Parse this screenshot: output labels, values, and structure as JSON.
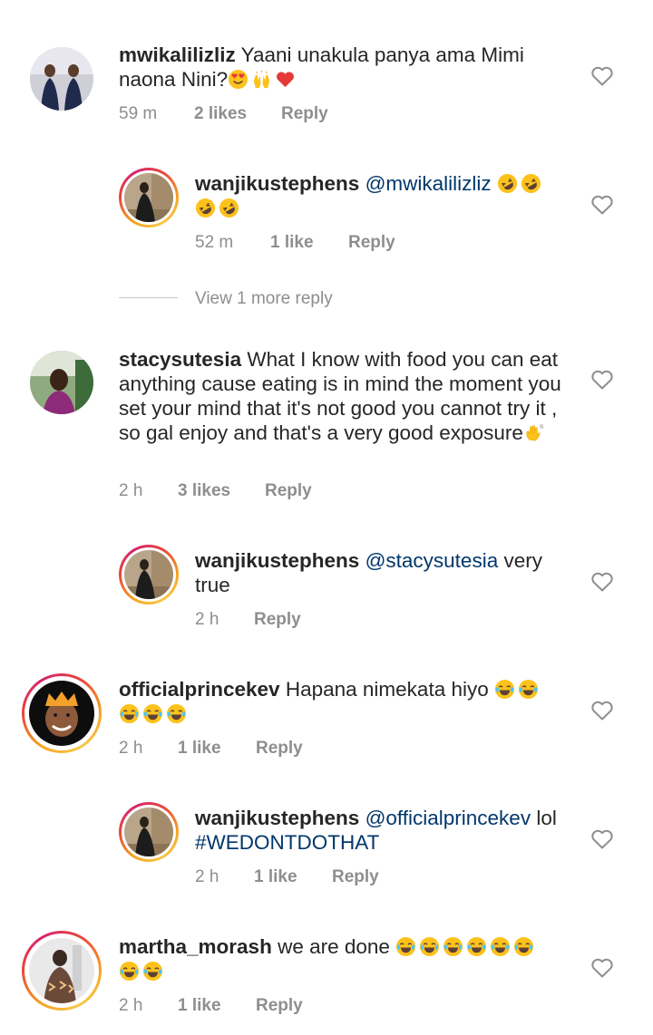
{
  "comments": [
    {
      "username": "mwikalilizliz",
      "text": "Yaani unakula panya ama Mimi naona Nini?",
      "emojis": [
        "heart-eyes",
        "raised-hands",
        "red-heart"
      ],
      "time": "59 m",
      "likes": "2 likes",
      "reply": "Reply"
    },
    {
      "username": "wanjikustephens",
      "mention": "@mwikalilizliz",
      "emojis": [
        "rofl",
        "rofl",
        "rofl",
        "rofl"
      ],
      "time": "52 m",
      "likes": "1 like",
      "reply": "Reply"
    },
    {
      "view_more": "View 1 more reply"
    },
    {
      "username": "stacysutesia",
      "text": "What I know with food you can eat anything cause eating is in mind the moment you set your mind that it's not good you cannot try it , so gal enjoy and that's a very good exposure",
      "emojis": [
        "waving-hand"
      ],
      "time": "2 h",
      "likes": "3 likes",
      "reply": "Reply"
    },
    {
      "username": "wanjikustephens",
      "mention": "@stacysutesia",
      "text": "very true",
      "time": "2 h",
      "reply": "Reply"
    },
    {
      "username": "officialprincekev",
      "text": "Hapana nimekata hiyo",
      "emojis": [
        "joy",
        "joy",
        "joy",
        "joy",
        "joy"
      ],
      "time": "2 h",
      "likes": "1 like",
      "reply": "Reply"
    },
    {
      "username": "wanjikustephens",
      "mention": "@officialprincekev",
      "text": "lol",
      "hashtag": "#WEDONTDOTHAT",
      "time": "2 h",
      "likes": "1 like",
      "reply": "Reply"
    },
    {
      "username": "martha_morash",
      "text": "we are done",
      "emojis": [
        "joy",
        "joy",
        "joy",
        "joy",
        "joy",
        "joy",
        "joy",
        "joy"
      ],
      "time": "2 h",
      "likes": "1 like",
      "reply": "Reply"
    }
  ],
  "colors": {
    "text": "#262626",
    "meta": "#8e8e8e",
    "mention": "#00376b",
    "story_ring_start": "#f5a623",
    "story_ring_end": "#d6246e"
  }
}
